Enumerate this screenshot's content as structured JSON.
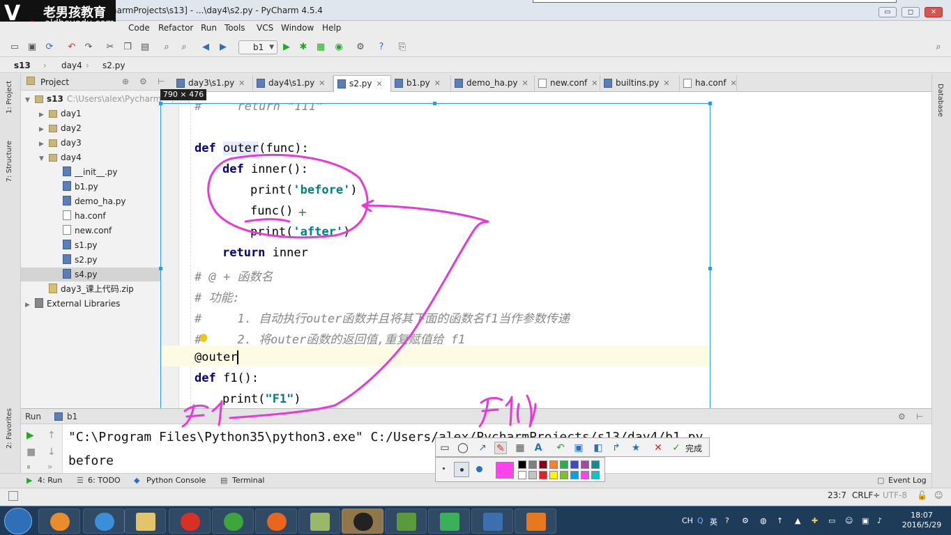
{
  "window": {
    "title": "harmProjects\\s13] - ...\\day4\\s2.py - PyCharm 4.5.4",
    "controls": [
      "▭",
      "◻",
      "✕"
    ]
  },
  "watermark": {
    "brand_cn": "老男孩教育",
    "url": "oldboyedu.com"
  },
  "menu": [
    "Code",
    "Refactor",
    "Run",
    "Tools",
    "VCS",
    "Window",
    "Help"
  ],
  "toolbar": {
    "run_config": "b1"
  },
  "breadcrumbs": [
    "s13",
    "day4",
    "s2.py"
  ],
  "left_strip": {
    "project": "1: Project",
    "structure": "7: Structure",
    "favorites": "2: Favorites"
  },
  "right_strip": {
    "database": "Database"
  },
  "project_panel": {
    "header": "Project",
    "tree": [
      {
        "label": "s13",
        "detail": "C:\\Users\\alex\\Pycharm",
        "icon": "folder-icon",
        "depth": 0,
        "expanded": true
      },
      {
        "label": "day1",
        "icon": "folder-icon",
        "depth": 1,
        "expanded": false
      },
      {
        "label": "day2",
        "icon": "folder-icon",
        "depth": 1,
        "expanded": false
      },
      {
        "label": "day3",
        "icon": "folder-icon",
        "depth": 1,
        "expanded": false
      },
      {
        "label": "day4",
        "icon": "folder-icon",
        "depth": 1,
        "expanded": true
      },
      {
        "label": "__init__.py",
        "icon": "python-file-icon",
        "depth": 2
      },
      {
        "label": "b1.py",
        "icon": "python-file-icon",
        "depth": 2
      },
      {
        "label": "demo_ha.py",
        "icon": "python-file-icon",
        "depth": 2
      },
      {
        "label": "ha.conf",
        "icon": "text-file-icon",
        "depth": 2
      },
      {
        "label": "new.conf",
        "icon": "text-file-icon",
        "depth": 2
      },
      {
        "label": "s1.py",
        "icon": "python-file-icon",
        "depth": 2
      },
      {
        "label": "s2.py",
        "icon": "python-file-icon",
        "depth": 2
      },
      {
        "label": "s4.py",
        "icon": "python-file-icon",
        "depth": 2,
        "selected": true
      },
      {
        "label": "day3_课上代码.zip",
        "icon": "zip-file-icon",
        "depth": 1
      },
      {
        "label": "External Libraries",
        "icon": "library-icon",
        "depth": 0,
        "expanded": false
      }
    ]
  },
  "tabs": [
    {
      "label": "day3\\s1.py"
    },
    {
      "label": "day4\\s1.py"
    },
    {
      "label": "s2.py",
      "active": true
    },
    {
      "label": "b1.py"
    },
    {
      "label": "demo_ha.py"
    },
    {
      "label": "new.conf"
    },
    {
      "label": "builtins.py"
    },
    {
      "label": "ha.conf"
    }
  ],
  "snapshot": {
    "size_label": "790 × 476"
  },
  "code": {
    "l0_comment": "#     return \"111\"",
    "l1_def": "def ",
    "l1_name": "outer",
    "l1_rest": "(func):",
    "l2_def": "def ",
    "l2_rest": "inner():",
    "l3_print": "print(",
    "l3_str": "'before'",
    "l3_close": ")",
    "l4_call": "func()",
    "l5_print": "print(",
    "l5_str": "'after'",
    "l5_close": ")",
    "l6_return": "return ",
    "l6_rest": "inner",
    "l7": "# @ + 函数名",
    "l8": "# 功能:",
    "l9": "#     1. 自动执行outer函数并且将其下面的函数名f1当作参数传递",
    "l10": "#     2. 将outer函数的返回值,重复赋值给 f1",
    "l11": "@outer",
    "l12_def": "def ",
    "l12_rest": "f1():",
    "l13_print": "print(",
    "l13_str": "\"F1\"",
    "l13_close": ")"
  },
  "annotations": {
    "handwritten_left": "f1",
    "handwritten_right": "f1()"
  },
  "run_panel": {
    "header_label": "Run",
    "config": "b1",
    "output_line1": "\"C:\\Program Files\\Python35\\python3.exe\" C:/Users/alex/PycharmProjects/s13/day4/b1.py",
    "output_line2": "before"
  },
  "annot_toolbar": {
    "done_label": "完成",
    "active_color": "#ff44ee",
    "palette_top": [
      "#000000",
      "#7f7f7f",
      "#880015",
      "#ff7f27",
      "#22b14c",
      "#3f48cc",
      "#a349a4",
      "#0f8f8f"
    ],
    "palette_bottom": [
      "#ffffff",
      "#c3c3c3",
      "#ed1c24",
      "#fff200",
      "#7fbf2f",
      "#00a2e8",
      "#ff44ee",
      "#00c8c8"
    ]
  },
  "tool_windows": [
    {
      "label": "4: Run"
    },
    {
      "label": "6: TODO"
    },
    {
      "label": "Python Console"
    },
    {
      "label": "Terminal"
    },
    {
      "label": "Event Log"
    }
  ],
  "status": {
    "position": "23:7",
    "line_sep": "CRLF÷",
    "encoding": "UTF-8"
  },
  "taskbar": {
    "ime": "CH",
    "lang": "英",
    "time": "18:07",
    "date": "2016/5/29"
  }
}
